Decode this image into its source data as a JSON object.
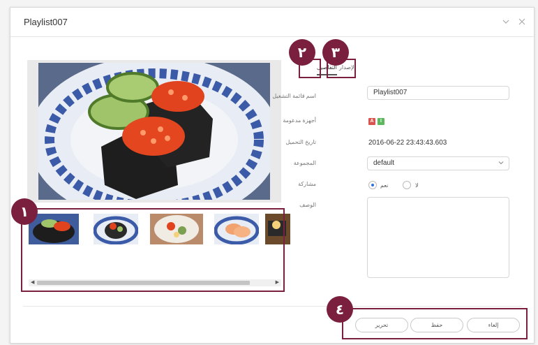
{
  "dialog": {
    "title": "Playlist007",
    "minimize_icon": "chevron-down-icon",
    "close_icon": "close-icon"
  },
  "tabs": [
    {
      "label": "التفاصيل",
      "active": true
    },
    {
      "label": "الإصدار",
      "active": false
    }
  ],
  "form": {
    "name_label": "اسم قائمة التشغيل",
    "name_value": "Playlist007",
    "devices_label": "أجهزة مدعومة",
    "device_badges": [
      "A",
      "I"
    ],
    "date_label": "تاريخ التحميل",
    "date_value": "2016-06-22 23:43:43.603",
    "group_label": "المجموعة",
    "group_value": "default",
    "share_label": "مشاركة",
    "share_yes": "نعم",
    "share_no": "لا",
    "share_selected": "نعم",
    "description_label": "الوصف",
    "description_value": ""
  },
  "buttons": {
    "edit": "تحرير",
    "save": "حفظ",
    "cancel": "إلغاء"
  },
  "callouts": [
    "١",
    "٢",
    "٣",
    "٤"
  ],
  "colors": {
    "callout": "#7a1f3e",
    "badge_a": "#d9534f",
    "badge_i": "#5cb85c",
    "radio_selected": "#2f6fe0"
  }
}
